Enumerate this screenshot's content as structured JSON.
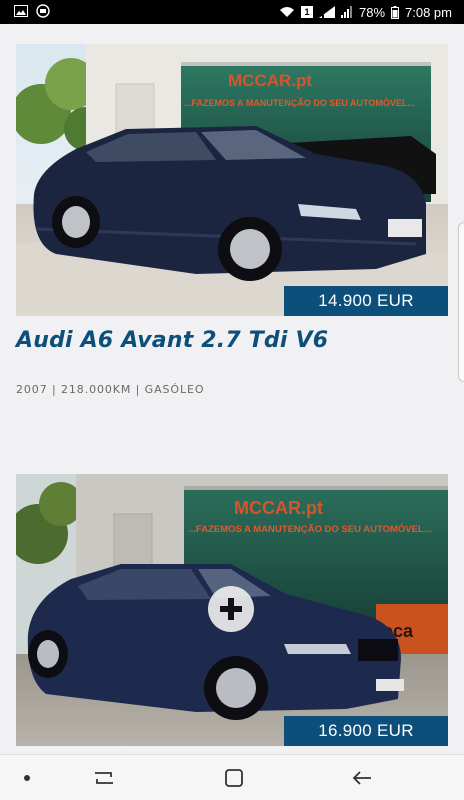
{
  "status_bar": {
    "left_icons": [
      "image-icon",
      "chat-icon"
    ],
    "sim_label": "1",
    "battery": "78%",
    "time": "7:08 pm"
  },
  "listings": [
    {
      "price": "14.900 EUR",
      "title": "Audi A6 Avant 2.7 Tdi V6",
      "specs": "2007 | 218.000KM | GASÓLEO",
      "car_color": "#1c2540"
    },
    {
      "price": "16.900 EUR",
      "car_color": "#1d2a4e"
    }
  ],
  "showroom": {
    "sign": "MCCAR.pt",
    "slogan": "...FAZEMOS A MANUTENÇÃO DO SEU AUTOMÓVEL...",
    "sign_color": "#d8542a"
  },
  "nav_bar": {
    "items": [
      "dot-icon",
      "recents-icon",
      "home-icon",
      "back-icon"
    ]
  },
  "colors": {
    "brand": "#0c4f7a",
    "price_bg": "#0b4f7a"
  }
}
